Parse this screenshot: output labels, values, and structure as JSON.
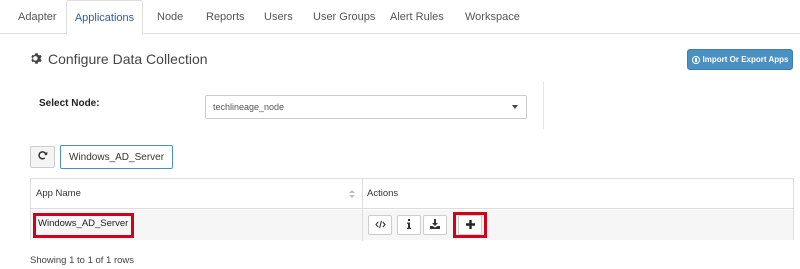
{
  "tabs": [
    {
      "label": "Adapter",
      "active": false
    },
    {
      "label": "Applications",
      "active": true
    },
    {
      "label": "Node",
      "active": false
    },
    {
      "label": "Reports",
      "active": false
    },
    {
      "label": "Users",
      "active": false
    },
    {
      "label": "User Groups",
      "active": false
    },
    {
      "label": "Alert Rules",
      "active": false
    },
    {
      "label": "Workspace",
      "active": false
    }
  ],
  "panel": {
    "title": "Configure Data Collection",
    "title_icon": "gear-icon",
    "export_button": "Import Or Export Apps",
    "export_icon": "globe-icon"
  },
  "node": {
    "label": "Select Node:",
    "selected": "techlineage_node"
  },
  "search": {
    "value": "Windows_AD_Server",
    "refresh_icon": "refresh-icon"
  },
  "table": {
    "columns": [
      "App Name",
      "Actions"
    ],
    "rows": [
      {
        "app_name": "Windows_AD_Server",
        "actions": [
          "code-icon",
          "info-icon",
          "download-icon",
          "plus-icon"
        ]
      }
    ]
  },
  "footer": {
    "text": "Showing 1 to 1 of 1 rows"
  },
  "colors": {
    "accent": "#4a90c2",
    "highlight": "#d0021b",
    "active_tab": "#2f5d9e"
  }
}
